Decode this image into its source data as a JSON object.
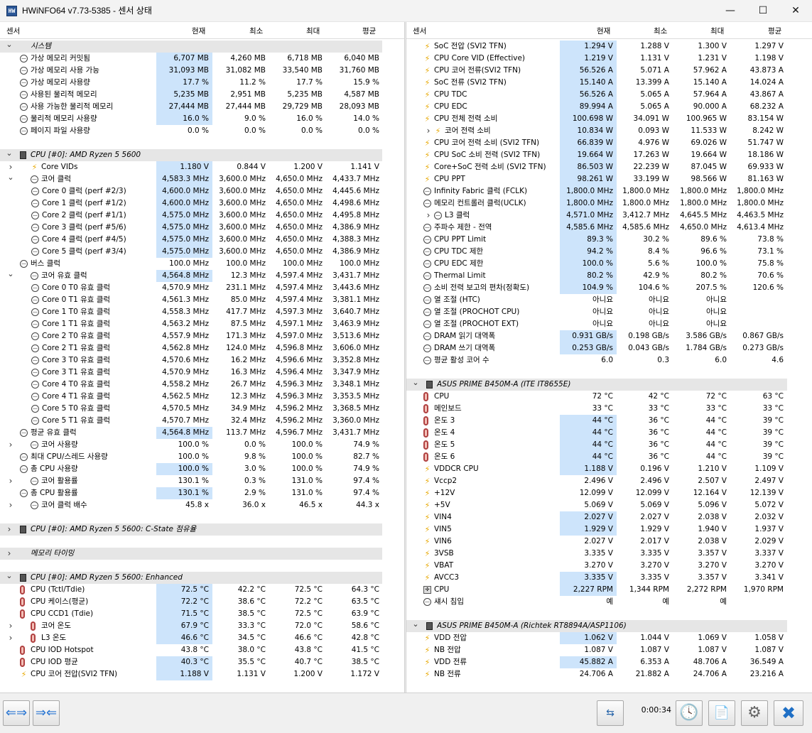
{
  "window": {
    "title": "HWiNFO64 v7.73-5385 - 센서 상태",
    "app_icon": "HW",
    "min": "—",
    "max": "☐",
    "close": "✕"
  },
  "columns": {
    "sensor": "센서",
    "current": "현재",
    "min": "최소",
    "max": "최대",
    "avg": "평균"
  },
  "left_rows": [
    {
      "t": "grp",
      "l": "시스템",
      "ex": "v"
    },
    {
      "t": "r",
      "i": "s",
      "l": "가상 메모리 커밋됨",
      "c": "6,707 MB",
      "mn": "4,260 MB",
      "mx": "6,718 MB",
      "a": "6,040 MB",
      "hl": 1
    },
    {
      "t": "r",
      "i": "s",
      "l": "가상 메모리 사용 가능",
      "c": "31,093 MB",
      "mn": "31,082 MB",
      "mx": "33,540 MB",
      "a": "31,760 MB",
      "hl": 1
    },
    {
      "t": "r",
      "i": "s",
      "l": "가상 메모리 사용량",
      "c": "17.7 %",
      "mn": "11.2 %",
      "mx": "17.7 %",
      "a": "15.9 %",
      "hl": 1
    },
    {
      "t": "r",
      "i": "s",
      "l": "사용된 물리적 메모리",
      "c": "5,235 MB",
      "mn": "2,951 MB",
      "mx": "5,235 MB",
      "a": "4,587 MB",
      "hl": 1
    },
    {
      "t": "r",
      "i": "s",
      "l": "사용 가능한 물리적 메모리",
      "c": "27,444 MB",
      "mn": "27,444 MB",
      "mx": "29,729 MB",
      "a": "28,093 MB",
      "hl": 1
    },
    {
      "t": "r",
      "i": "s",
      "l": "물리적 메모리 사용량",
      "c": "16.0 %",
      "mn": "9.0 %",
      "mx": "16.0 %",
      "a": "14.0 %",
      "hl": 1
    },
    {
      "t": "r",
      "i": "s",
      "l": "페이지 파일 사용량",
      "c": "0.0 %",
      "mn": "0.0 %",
      "mx": "0.0 %",
      "a": "0.0 %"
    },
    {
      "t": "blank"
    },
    {
      "t": "grp",
      "l": "CPU [#0]: AMD Ryzen 5 5600",
      "ex": "v",
      "chip": 1
    },
    {
      "t": "r",
      "i": "b",
      "l": "Core VIDs",
      "ex": ">",
      "c": "1.180 V",
      "mn": "0.844 V",
      "mx": "1.200 V",
      "a": "1.141 V",
      "hl": 1
    },
    {
      "t": "r",
      "i": "s",
      "l": "코어 클럭",
      "ex": "v",
      "c": "4,583.3 MHz",
      "mn": "3,600.0 MHz",
      "mx": "4,650.0 MHz",
      "a": "4,433.7 MHz",
      "hl": 1
    },
    {
      "t": "r",
      "i": "s",
      "l": "Core 0 클럭 (perf #2/3)",
      "c": "4,600.0 MHz",
      "mn": "3,600.0 MHz",
      "mx": "4,650.0 MHz",
      "a": "4,445.6 MHz",
      "hl": 1,
      "d": 2
    },
    {
      "t": "r",
      "i": "s",
      "l": "Core 1 클럭 (perf #1/2)",
      "c": "4,600.0 MHz",
      "mn": "3,600.0 MHz",
      "mx": "4,650.0 MHz",
      "a": "4,498.6 MHz",
      "hl": 1,
      "d": 2
    },
    {
      "t": "r",
      "i": "s",
      "l": "Core 2 클럭 (perf #1/1)",
      "c": "4,575.0 MHz",
      "mn": "3,600.0 MHz",
      "mx": "4,650.0 MHz",
      "a": "4,495.8 MHz",
      "hl": 1,
      "d": 2
    },
    {
      "t": "r",
      "i": "s",
      "l": "Core 3 클럭 (perf #5/6)",
      "c": "4,575.0 MHz",
      "mn": "3,600.0 MHz",
      "mx": "4,650.0 MHz",
      "a": "4,386.9 MHz",
      "hl": 1,
      "d": 2
    },
    {
      "t": "r",
      "i": "s",
      "l": "Core 4 클럭 (perf #4/5)",
      "c": "4,575.0 MHz",
      "mn": "3,600.0 MHz",
      "mx": "4,650.0 MHz",
      "a": "4,388.3 MHz",
      "hl": 1,
      "d": 2
    },
    {
      "t": "r",
      "i": "s",
      "l": "Core 5 클럭 (perf #3/4)",
      "c": "4,575.0 MHz",
      "mn": "3,600.0 MHz",
      "mx": "4,650.0 MHz",
      "a": "4,386.9 MHz",
      "hl": 1,
      "d": 2
    },
    {
      "t": "r",
      "i": "s",
      "l": "버스 클럭",
      "c": "100.0 MHz",
      "mn": "100.0 MHz",
      "mx": "100.0 MHz",
      "a": "100.0 MHz"
    },
    {
      "t": "r",
      "i": "s",
      "l": "코어 유효 클럭",
      "ex": "v",
      "c": "4,564.8 MHz",
      "mn": "12.3 MHz",
      "mx": "4,597.4 MHz",
      "a": "3,431.7 MHz",
      "hl": 1
    },
    {
      "t": "r",
      "i": "s",
      "l": "Core 0 T0 유효 클럭",
      "c": "4,570.9 MHz",
      "mn": "231.1 MHz",
      "mx": "4,597.4 MHz",
      "a": "3,443.6 MHz",
      "d": 2
    },
    {
      "t": "r",
      "i": "s",
      "l": "Core 0 T1 유효 클럭",
      "c": "4,561.3 MHz",
      "mn": "85.0 MHz",
      "mx": "4,597.4 MHz",
      "a": "3,381.1 MHz",
      "d": 2
    },
    {
      "t": "r",
      "i": "s",
      "l": "Core 1 T0 유효 클럭",
      "c": "4,558.3 MHz",
      "mn": "417.7 MHz",
      "mx": "4,597.3 MHz",
      "a": "3,640.7 MHz",
      "d": 2
    },
    {
      "t": "r",
      "i": "s",
      "l": "Core 1 T1 유효 클럭",
      "c": "4,563.2 MHz",
      "mn": "87.5 MHz",
      "mx": "4,597.1 MHz",
      "a": "3,463.9 MHz",
      "d": 2
    },
    {
      "t": "r",
      "i": "s",
      "l": "Core 2 T0 유효 클럭",
      "c": "4,557.9 MHz",
      "mn": "171.3 MHz",
      "mx": "4,597.0 MHz",
      "a": "3,513.6 MHz",
      "d": 2
    },
    {
      "t": "r",
      "i": "s",
      "l": "Core 2 T1 유효 클럭",
      "c": "4,562.8 MHz",
      "mn": "124.0 MHz",
      "mx": "4,596.8 MHz",
      "a": "3,606.0 MHz",
      "d": 2
    },
    {
      "t": "r",
      "i": "s",
      "l": "Core 3 T0 유효 클럭",
      "c": "4,570.6 MHz",
      "mn": "16.2 MHz",
      "mx": "4,596.6 MHz",
      "a": "3,352.8 MHz",
      "d": 2
    },
    {
      "t": "r",
      "i": "s",
      "l": "Core 3 T1 유효 클럭",
      "c": "4,570.9 MHz",
      "mn": "16.3 MHz",
      "mx": "4,596.4 MHz",
      "a": "3,347.9 MHz",
      "d": 2
    },
    {
      "t": "r",
      "i": "s",
      "l": "Core 4 T0 유효 클럭",
      "c": "4,558.2 MHz",
      "mn": "26.7 MHz",
      "mx": "4,596.3 MHz",
      "a": "3,348.1 MHz",
      "d": 2
    },
    {
      "t": "r",
      "i": "s",
      "l": "Core 4 T1 유효 클럭",
      "c": "4,562.5 MHz",
      "mn": "12.3 MHz",
      "mx": "4,596.3 MHz",
      "a": "3,353.5 MHz",
      "d": 2
    },
    {
      "t": "r",
      "i": "s",
      "l": "Core 5 T0 유효 클럭",
      "c": "4,570.5 MHz",
      "mn": "34.9 MHz",
      "mx": "4,596.2 MHz",
      "a": "3,368.5 MHz",
      "d": 2
    },
    {
      "t": "r",
      "i": "s",
      "l": "Core 5 T1 유효 클럭",
      "c": "4,570.7 MHz",
      "mn": "32.4 MHz",
      "mx": "4,596.2 MHz",
      "a": "3,360.0 MHz",
      "d": 2
    },
    {
      "t": "r",
      "i": "s",
      "l": "평균 유효 클럭",
      "c": "4,564.8 MHz",
      "mn": "113.7 MHz",
      "mx": "4,596.7 MHz",
      "a": "3,431.7 MHz",
      "hl": 1
    },
    {
      "t": "r",
      "i": "s",
      "l": "코어 사용량",
      "ex": ">",
      "c": "100.0 %",
      "mn": "0.0 %",
      "mx": "100.0 %",
      "a": "74.9 %"
    },
    {
      "t": "r",
      "i": "s",
      "l": "최대 CPU/스레드 사용량",
      "c": "100.0 %",
      "mn": "9.8 %",
      "mx": "100.0 %",
      "a": "82.7 %"
    },
    {
      "t": "r",
      "i": "s",
      "l": "총 CPU 사용량",
      "c": "100.0 %",
      "mn": "3.0 %",
      "mx": "100.0 %",
      "a": "74.9 %",
      "hl": 1
    },
    {
      "t": "r",
      "i": "s",
      "l": "코어 활용률",
      "ex": ">",
      "c": "130.1 %",
      "mn": "0.3 %",
      "mx": "131.0 %",
      "a": "97.4 %"
    },
    {
      "t": "r",
      "i": "s",
      "l": "총 CPU 활용률",
      "c": "130.1 %",
      "mn": "2.9 %",
      "mx": "131.0 %",
      "a": "97.4 %",
      "hl": 1
    },
    {
      "t": "r",
      "i": "s",
      "l": "코어 클럭 배수",
      "ex": ">",
      "c": "45.8 x",
      "mn": "36.0 x",
      "mx": "46.5 x",
      "a": "44.3 x"
    },
    {
      "t": "blank"
    },
    {
      "t": "grp",
      "l": "CPU [#0]: AMD Ryzen 5 5600: C-State 점유율",
      "ex": ">",
      "chip": 1
    },
    {
      "t": "blank"
    },
    {
      "t": "grp",
      "l": "메모리 타이밍",
      "ex": ">"
    },
    {
      "t": "blank"
    },
    {
      "t": "grp",
      "l": "CPU [#0]: AMD Ryzen 5 5600: Enhanced",
      "ex": "v",
      "chip": 1
    },
    {
      "t": "r",
      "i": "t",
      "l": "CPU (Tctl/Tdie)",
      "c": "72.5 °C",
      "mn": "42.2 °C",
      "mx": "72.5 °C",
      "a": "64.3 °C",
      "hl": 1
    },
    {
      "t": "r",
      "i": "t",
      "l": "CPU 케이스(평균)",
      "c": "72.2 °C",
      "mn": "38.6 °C",
      "mx": "72.2 °C",
      "a": "63.5 °C",
      "hl": 1
    },
    {
      "t": "r",
      "i": "t",
      "l": "CPU CCD1 (Tdie)",
      "c": "71.5 °C",
      "mn": "38.5 °C",
      "mx": "72.5 °C",
      "a": "63.9 °C",
      "hl": 1
    },
    {
      "t": "r",
      "i": "t",
      "l": "코어 온도",
      "ex": ">",
      "c": "67.9 °C",
      "mn": "33.3 °C",
      "mx": "72.0 °C",
      "a": "58.6 °C",
      "hl": 1
    },
    {
      "t": "r",
      "i": "t",
      "l": "L3 온도",
      "ex": ">",
      "c": "46.6 °C",
      "mn": "34.5 °C",
      "mx": "46.6 °C",
      "a": "42.8 °C",
      "hl": 1
    },
    {
      "t": "r",
      "i": "t",
      "l": "CPU IOD Hotspot",
      "c": "43.8 °C",
      "mn": "38.0 °C",
      "mx": "43.8 °C",
      "a": "41.5 °C"
    },
    {
      "t": "r",
      "i": "t",
      "l": "CPU IOD 평균",
      "c": "40.3 °C",
      "mn": "35.5 °C",
      "mx": "40.7 °C",
      "a": "38.5 °C",
      "hl": 1
    },
    {
      "t": "r",
      "i": "b",
      "l": "CPU 코어 전압(SVI2 TFN)",
      "c": "1.188 V",
      "mn": "1.131 V",
      "mx": "1.200 V",
      "a": "1.172 V",
      "hl": 1
    }
  ],
  "right_rows": [
    {
      "t": "r",
      "i": "b",
      "l": "SoC 전압 (SVI2 TFN)",
      "c": "1.294 V",
      "mn": "1.288 V",
      "mx": "1.300 V",
      "a": "1.297 V",
      "hl": 1
    },
    {
      "t": "r",
      "i": "b",
      "l": "CPU Core VID (Effective)",
      "c": "1.219 V",
      "mn": "1.131 V",
      "mx": "1.231 V",
      "a": "1.198 V",
      "hl": 1
    },
    {
      "t": "r",
      "i": "b",
      "l": "CPU 코어 전류(SVI2 TFN)",
      "c": "56.526 A",
      "mn": "5.071 A",
      "mx": "57.962 A",
      "a": "43.873 A",
      "hl": 1
    },
    {
      "t": "r",
      "i": "b",
      "l": "SoC 전류 (SVI2 TFN)",
      "c": "15.140 A",
      "mn": "13.399 A",
      "mx": "15.140 A",
      "a": "14.024 A",
      "hl": 1
    },
    {
      "t": "r",
      "i": "b",
      "l": "CPU TDC",
      "c": "56.526 A",
      "mn": "5.065 A",
      "mx": "57.964 A",
      "a": "43.867 A",
      "hl": 1
    },
    {
      "t": "r",
      "i": "b",
      "l": "CPU EDC",
      "c": "89.994 A",
      "mn": "5.065 A",
      "mx": "90.000 A",
      "a": "68.232 A",
      "hl": 1
    },
    {
      "t": "r",
      "i": "b",
      "l": "CPU 전체 전력 소비",
      "c": "100.698 W",
      "mn": "34.091 W",
      "mx": "100.965 W",
      "a": "83.154 W",
      "hl": 1
    },
    {
      "t": "r",
      "i": "b",
      "l": "코어 전력 소비",
      "ex": ">",
      "c": "10.834 W",
      "mn": "0.093 W",
      "mx": "11.533 W",
      "a": "8.242 W",
      "hl": 1
    },
    {
      "t": "r",
      "i": "b",
      "l": "CPU 코어 전력 소비 (SVI2 TFN)",
      "c": "66.839 W",
      "mn": "4.976 W",
      "mx": "69.026 W",
      "a": "51.747 W",
      "hl": 1
    },
    {
      "t": "r",
      "i": "b",
      "l": "CPU SoC 소비 전력 (SVI2 TFN)",
      "c": "19.664 W",
      "mn": "17.263 W",
      "mx": "19.664 W",
      "a": "18.186 W",
      "hl": 1
    },
    {
      "t": "r",
      "i": "b",
      "l": "Core+SoC 전력 소비 (SVI2 TFN)",
      "c": "86.503 W",
      "mn": "22.239 W",
      "mx": "87.045 W",
      "a": "69.933 W",
      "hl": 1
    },
    {
      "t": "r",
      "i": "b",
      "l": "CPU PPT",
      "c": "98.261 W",
      "mn": "33.199 W",
      "mx": "98.566 W",
      "a": "81.163 W",
      "hl": 1
    },
    {
      "t": "r",
      "i": "s",
      "l": "Infinity Fabric 클럭 (FCLK)",
      "c": "1,800.0 MHz",
      "mn": "1,800.0 MHz",
      "mx": "1,800.0 MHz",
      "a": "1,800.0 MHz",
      "hl": 1
    },
    {
      "t": "r",
      "i": "s",
      "l": "메모리 컨트롤러 클럭(UCLK)",
      "c": "1,800.0 MHz",
      "mn": "1,800.0 MHz",
      "mx": "1,800.0 MHz",
      "a": "1,800.0 MHz",
      "hl": 1
    },
    {
      "t": "r",
      "i": "s",
      "l": "L3 클럭",
      "ex": ">",
      "c": "4,571.0 MHz",
      "mn": "3,412.7 MHz",
      "mx": "4,645.5 MHz",
      "a": "4,463.5 MHz",
      "hl": 1
    },
    {
      "t": "r",
      "i": "s",
      "l": "주파수 제한 - 전역",
      "c": "4,585.6 MHz",
      "mn": "4,585.6 MHz",
      "mx": "4,650.0 MHz",
      "a": "4,613.4 MHz",
      "hl": 1
    },
    {
      "t": "r",
      "i": "s",
      "l": "CPU PPT Limit",
      "c": "89.3 %",
      "mn": "30.2 %",
      "mx": "89.6 %",
      "a": "73.8 %",
      "hl": 1
    },
    {
      "t": "r",
      "i": "s",
      "l": "CPU TDC 제한",
      "c": "94.2 %",
      "mn": "8.4 %",
      "mx": "96.6 %",
      "a": "73.1 %",
      "hl": 1
    },
    {
      "t": "r",
      "i": "s",
      "l": "CPU EDC 제한",
      "c": "100.0 %",
      "mn": "5.6 %",
      "mx": "100.0 %",
      "a": "75.8 %",
      "hl": 1
    },
    {
      "t": "r",
      "i": "s",
      "l": "Thermal Limit",
      "c": "80.2 %",
      "mn": "42.9 %",
      "mx": "80.2 %",
      "a": "70.6 %",
      "hl": 1
    },
    {
      "t": "r",
      "i": "s",
      "l": "소비 전력 보고의 편차(정확도)",
      "c": "104.9 %",
      "mn": "104.6 %",
      "mx": "207.5 %",
      "a": "120.6 %",
      "hl": 1
    },
    {
      "t": "r",
      "i": "s",
      "l": "열 조절 (HTC)",
      "c": "아니요",
      "mn": "아니요",
      "mx": "아니요",
      "a": ""
    },
    {
      "t": "r",
      "i": "s",
      "l": "열 조절 (PROCHOT CPU)",
      "c": "아니요",
      "mn": "아니요",
      "mx": "아니요",
      "a": ""
    },
    {
      "t": "r",
      "i": "s",
      "l": "열 조절 (PROCHOT EXT)",
      "c": "아니요",
      "mn": "아니요",
      "mx": "아니요",
      "a": ""
    },
    {
      "t": "r",
      "i": "s",
      "l": "DRAM 읽기 대역폭",
      "c": "0.931 GB/s",
      "mn": "0.198 GB/s",
      "mx": "3.586 GB/s",
      "a": "0.867 GB/s",
      "hl": 1
    },
    {
      "t": "r",
      "i": "s",
      "l": "DRAM 쓰기 대역폭",
      "c": "0.253 GB/s",
      "mn": "0.043 GB/s",
      "mx": "1.784 GB/s",
      "a": "0.273 GB/s",
      "hl": 1
    },
    {
      "t": "r",
      "i": "s",
      "l": "평균 활성 코어 수",
      "c": "6.0",
      "mn": "0.3",
      "mx": "6.0",
      "a": "4.6"
    },
    {
      "t": "blank"
    },
    {
      "t": "grp",
      "l": "ASUS PRIME B450M-A (ITE IT8655E)",
      "ex": "v",
      "chip": 1
    },
    {
      "t": "r",
      "i": "t",
      "l": "CPU",
      "c": "72 °C",
      "mn": "42 °C",
      "mx": "72 °C",
      "a": "63 °C"
    },
    {
      "t": "r",
      "i": "t",
      "l": "메인보드",
      "c": "33 °C",
      "mn": "33 °C",
      "mx": "33 °C",
      "a": "33 °C"
    },
    {
      "t": "r",
      "i": "t",
      "l": "온도 3",
      "c": "44 °C",
      "mn": "36 °C",
      "mx": "44 °C",
      "a": "39 °C",
      "hl": 1
    },
    {
      "t": "r",
      "i": "t",
      "l": "온도 4",
      "c": "44 °C",
      "mn": "36 °C",
      "mx": "44 °C",
      "a": "39 °C",
      "hl": 1
    },
    {
      "t": "r",
      "i": "t",
      "l": "온도 5",
      "c": "44 °C",
      "mn": "36 °C",
      "mx": "44 °C",
      "a": "39 °C",
      "hl": 1
    },
    {
      "t": "r",
      "i": "t",
      "l": "온도 6",
      "c": "44 °C",
      "mn": "36 °C",
      "mx": "44 °C",
      "a": "39 °C",
      "hl": 1
    },
    {
      "t": "r",
      "i": "b",
      "l": "VDDCR CPU",
      "c": "1.188 V",
      "mn": "0.196 V",
      "mx": "1.210 V",
      "a": "1.109 V",
      "hl": 1
    },
    {
      "t": "r",
      "i": "b",
      "l": "Vccp2",
      "c": "2.496 V",
      "mn": "2.496 V",
      "mx": "2.507 V",
      "a": "2.497 V"
    },
    {
      "t": "r",
      "i": "b",
      "l": "+12V",
      "c": "12.099 V",
      "mn": "12.099 V",
      "mx": "12.164 V",
      "a": "12.139 V"
    },
    {
      "t": "r",
      "i": "b",
      "l": "+5V",
      "c": "5.069 V",
      "mn": "5.069 V",
      "mx": "5.096 V",
      "a": "5.072 V"
    },
    {
      "t": "r",
      "i": "b",
      "l": "VIN4",
      "c": "2.027 V",
      "mn": "2.027 V",
      "mx": "2.038 V",
      "a": "2.032 V",
      "hl": 1
    },
    {
      "t": "r",
      "i": "b",
      "l": "VIN5",
      "c": "1.929 V",
      "mn": "1.929 V",
      "mx": "1.940 V",
      "a": "1.937 V",
      "hl": 1
    },
    {
      "t": "r",
      "i": "b",
      "l": "VIN6",
      "c": "2.027 V",
      "mn": "2.017 V",
      "mx": "2.038 V",
      "a": "2.029 V"
    },
    {
      "t": "r",
      "i": "b",
      "l": "3VSB",
      "c": "3.335 V",
      "mn": "3.335 V",
      "mx": "3.357 V",
      "a": "3.337 V"
    },
    {
      "t": "r",
      "i": "b",
      "l": "VBAT",
      "c": "3.270 V",
      "mn": "3.270 V",
      "mx": "3.270 V",
      "a": "3.270 V"
    },
    {
      "t": "r",
      "i": "b",
      "l": "AVCC3",
      "c": "3.335 V",
      "mn": "3.335 V",
      "mx": "3.357 V",
      "a": "3.341 V",
      "hl": 1
    },
    {
      "t": "r",
      "i": "f",
      "l": "CPU",
      "c": "2,227 RPM",
      "mn": "1,344 RPM",
      "mx": "2,272 RPM",
      "a": "1,970 RPM",
      "hl": 1
    },
    {
      "t": "r",
      "i": "s",
      "l": "섀시 침입",
      "c": "예",
      "mn": "예",
      "mx": "예",
      "a": ""
    },
    {
      "t": "blank"
    },
    {
      "t": "grp",
      "l": "ASUS PRIME B450M-A (Richtek RT8894A/ASP1106)",
      "ex": "v",
      "chip": 1
    },
    {
      "t": "r",
      "i": "b",
      "l": "VDD 전압",
      "c": "1.062 V",
      "mn": "1.044 V",
      "mx": "1.069 V",
      "a": "1.058 V",
      "hl": 1
    },
    {
      "t": "r",
      "i": "b",
      "l": "NB 전압",
      "c": "1.087 V",
      "mn": "1.087 V",
      "mx": "1.087 V",
      "a": "1.087 V"
    },
    {
      "t": "r",
      "i": "b",
      "l": "VDD 전류",
      "c": "45.882 A",
      "mn": "6.353 A",
      "mx": "48.706 A",
      "a": "36.549 A",
      "hl": 1
    },
    {
      "t": "r",
      "i": "b",
      "l": "NB 전류",
      "c": "24.706 A",
      "mn": "21.882 A",
      "mx": "24.706 A",
      "a": "23.216 A"
    }
  ],
  "toolbar": {
    "nav_left": "⇐⇒",
    "nav_right": "⇒⇐",
    "network": "⇆",
    "timer": "0:00:34",
    "clock": "🕓",
    "report": "📄",
    "settings": "⚙",
    "close": "✖"
  }
}
